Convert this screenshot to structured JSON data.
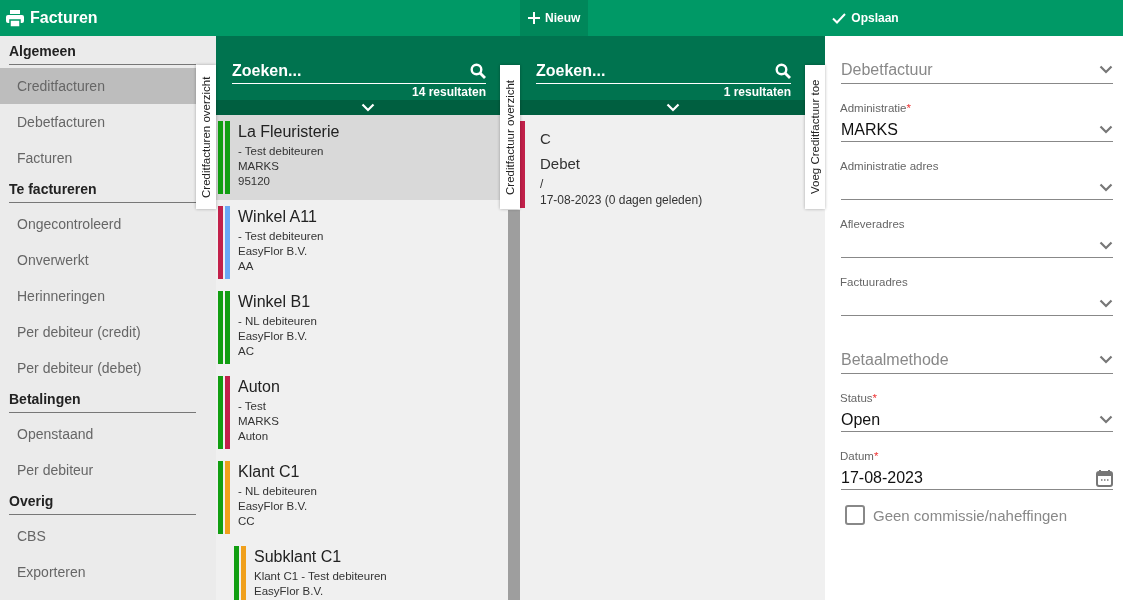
{
  "header": {
    "title": "Facturen",
    "actions": [
      {
        "label": "Nieuw",
        "kind": "add",
        "selected": true
      },
      {
        "label": "Opslaan",
        "kind": "save",
        "selected": false
      }
    ]
  },
  "sidebar": {
    "sections": [
      {
        "title": "Algemeen",
        "items": [
          {
            "label": "Creditfacturen",
            "selected": true
          },
          {
            "label": "Debetfacturen",
            "selected": false
          },
          {
            "label": "Facturen",
            "selected": false
          }
        ]
      },
      {
        "title": "Te factureren",
        "items": [
          {
            "label": "Ongecontroleerd",
            "selected": false
          },
          {
            "label": "Onverwerkt",
            "selected": false
          },
          {
            "label": "Herinneringen",
            "selected": false
          },
          {
            "label": "Per debiteur (credit)",
            "selected": false
          },
          {
            "label": "Per debiteur (debet)",
            "selected": false
          }
        ]
      },
      {
        "title": "Betalingen",
        "items": [
          {
            "label": "Openstaand",
            "selected": false
          },
          {
            "label": "Per debiteur",
            "selected": false
          }
        ]
      },
      {
        "title": "Overig",
        "items": [
          {
            "label": "CBS",
            "selected": false
          },
          {
            "label": "Exporteren",
            "selected": false
          }
        ]
      }
    ]
  },
  "list_panel": {
    "side_tab": "Creditfacturen overzicht",
    "search": {
      "placeholder": "Zoeken..."
    },
    "result_count": "14 resultaten",
    "items": [
      {
        "title": "La Fleuristerie",
        "lines": [
          "- Test debiteuren",
          "MARKS",
          "95120"
        ],
        "selected": true,
        "bars": [
          {
            "color": "#119e11"
          },
          {
            "color": "#119e11"
          }
        ]
      },
      {
        "title": "Winkel A11",
        "lines": [
          "- Test debiteuren",
          "EasyFlor B.V.",
          "AA"
        ],
        "selected": false,
        "bars": [
          {
            "color": "#c2204a"
          },
          {
            "color": "#6aa8f5"
          }
        ]
      },
      {
        "title": "Winkel B1",
        "lines": [
          "- NL debiteuren",
          "EasyFlor B.V.",
          "AC"
        ],
        "selected": false,
        "bars": [
          {
            "color": "#119e11"
          },
          {
            "color": "#119e11"
          }
        ]
      },
      {
        "title": "Auton",
        "lines": [
          "- Test",
          "MARKS",
          "Auton"
        ],
        "selected": false,
        "bars": [
          {
            "color": "#119e11"
          },
          {
            "color": "#c2204a"
          }
        ]
      },
      {
        "title": "Klant C1",
        "lines": [
          "- NL debiteuren",
          "EasyFlor B.V.",
          "CC"
        ],
        "selected": false,
        "bars": [
          {
            "color": "#119e11"
          },
          {
            "color": "#f0a01c"
          }
        ],
        "children": [
          {
            "title": "Subklant C1",
            "lines": [
              "Klant C1 - Test debiteuren",
              "EasyFlor B.V."
            ],
            "selected": false,
            "bars": [
              {
                "color": "#119e11"
              },
              {
                "color": "#f0a01c"
              }
            ]
          }
        ]
      }
    ]
  },
  "detail_panel": {
    "side_tab": "Creditfactuur overzicht",
    "search": {
      "placeholder": "Zoeken..."
    },
    "result_count": "1 resultaten",
    "items": [
      {
        "lines": [
          "C",
          "Debet",
          "/",
          "17-08-2023 (0 dagen geleden)"
        ],
        "color": "#c2204a"
      }
    ]
  },
  "form": {
    "side_tab": "Voeg Creditfactuur toe",
    "fields": [
      {
        "kind": "select",
        "placeholder": "Debetfactuur"
      },
      {
        "kind": "select",
        "label": "Administratie",
        "required_mark": "*",
        "value": "MARKS"
      },
      {
        "kind": "select",
        "label": "Administratie adres"
      },
      {
        "kind": "select",
        "label": "Afleveradres"
      },
      {
        "kind": "select",
        "label": "Factuuradres"
      },
      {
        "kind": "select",
        "placeholder": "Betaalmethode"
      },
      {
        "kind": "select",
        "label": "Status",
        "required_mark": "*",
        "value": "Open"
      },
      {
        "kind": "date",
        "label": "Datum",
        "required_mark": "*",
        "value": "17-08-2023"
      },
      {
        "kind": "checkbox",
        "label": "Geen commissie/naheffingen",
        "checked": false
      }
    ]
  }
}
